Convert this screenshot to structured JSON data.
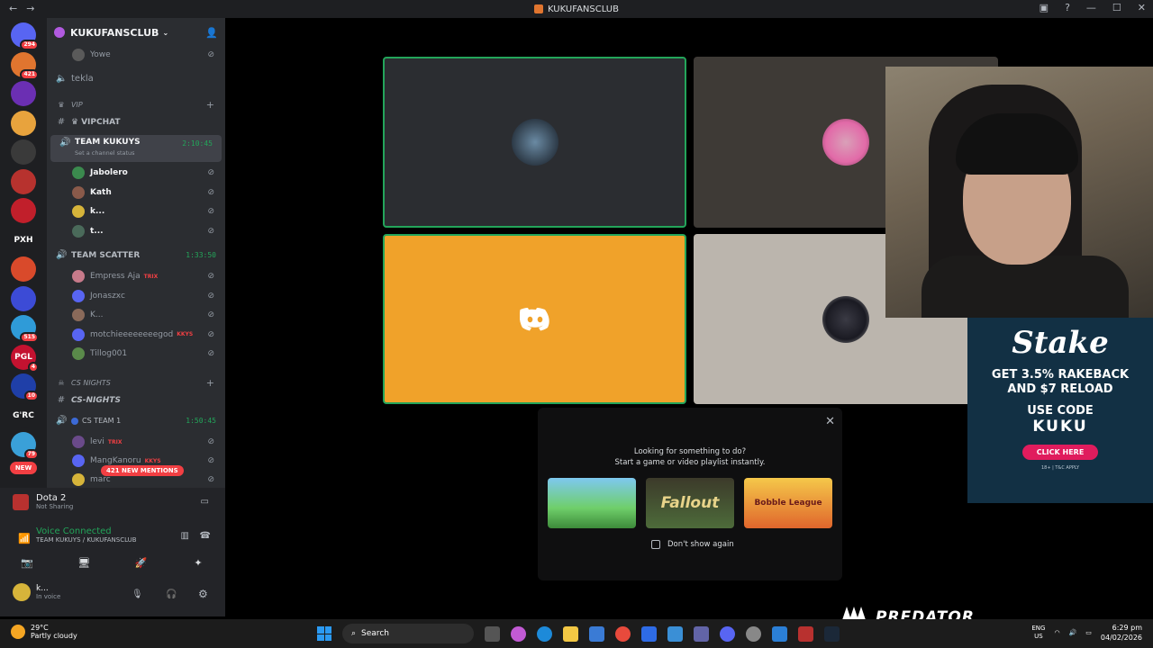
{
  "window": {
    "title": "KUKUFANSCLUB",
    "back": "←",
    "forward": "→"
  },
  "servers": [
    {
      "label": "",
      "badge": "294",
      "color": "#5865f2"
    },
    {
      "label": "",
      "badge": "421",
      "color": "#e0752f"
    },
    {
      "label": "",
      "badge": "",
      "color": "#6b2fb3"
    },
    {
      "label": "",
      "badge": "",
      "color": "#e8a33d"
    },
    {
      "label": "",
      "badge": "",
      "color": "#3a3a3a"
    },
    {
      "label": "",
      "badge": "",
      "color": "#b7322e"
    },
    {
      "label": "",
      "badge": "",
      "color": "#c11f2b"
    },
    {
      "label": "PXH",
      "badge": "",
      "color": "#1e1f22"
    },
    {
      "label": "",
      "badge": "",
      "color": "#d94a2b"
    },
    {
      "label": "",
      "badge": "",
      "color": "#3c4bd6"
    },
    {
      "label": "",
      "badge": "515",
      "color": "#2f9bd8"
    },
    {
      "label": "PGL",
      "badge": "4",
      "color": "#c41230"
    },
    {
      "label": "",
      "badge": "10",
      "color": "#1f3fa8"
    },
    {
      "label": "G'RC",
      "badge": "",
      "color": "#1e1f22"
    },
    {
      "label": "",
      "badge": "79",
      "color": "#3aa0d8"
    },
    {
      "label": "NEW",
      "badge": "",
      "color": "#f23f43"
    }
  ],
  "guild": {
    "name": "KUKUFANSCLUB"
  },
  "channels": {
    "yowe": "Yowe",
    "tekla": "tekla",
    "vip_category": "VIP",
    "vipchat": "VIPCHAT",
    "team_kukuys": "TEAM KUKUYS",
    "team_kukuys_timer": "2:10:45",
    "team_kukuys_status": "Set a channel status",
    "kukuys_members": [
      "Jabolero",
      "Kath",
      "k...",
      "t..."
    ],
    "team_scatter": "TEAM SCATTER",
    "team_scatter_timer": "1:33:50",
    "scatter_members": [
      {
        "name": "Empress Aja",
        "tag": "TRIX"
      },
      {
        "name": "Jonaszxc",
        "tag": ""
      },
      {
        "name": "K...",
        "tag": ""
      },
      {
        "name": "motchieeeeeeeegod",
        "tag": "KKYS"
      },
      {
        "name": "Tillog001",
        "tag": ""
      }
    ],
    "cs_category": "CS NIGHTS",
    "cs_nights": "CS-NIGHTS",
    "cs_team": "CS TEAM 1",
    "cs_team_timer": "1:50:45",
    "cs_members": [
      {
        "name": "levi",
        "tag": "TRIX"
      },
      {
        "name": "MangKanoru",
        "tag": "KKYS"
      },
      {
        "name": "marc",
        "tag": ""
      }
    ],
    "new_mentions": "421 NEW MENTIONS"
  },
  "user_panel": {
    "activity_title": "Dota 2",
    "activity_sub": "Not Sharing",
    "voice_status": "Voice Connected",
    "voice_location": "TEAM KUKUYS / KUKUFANSCLUB",
    "username": "k...",
    "user_status": "In voice"
  },
  "suggestion": {
    "line1": "Looking for something to do?",
    "line2": "Start a game or video playlist instantly.",
    "games": [
      "",
      "Fallout",
      "Bobble League"
    ],
    "dont_show": "Don't show again"
  },
  "stake": {
    "brand": "Stake",
    "promo_line1": "GET 3.5% RAKEBACK",
    "promo_line2": "AND $7 RELOAD",
    "use_code": "USE CODE",
    "code": "KUKU",
    "cta": "CLICK HERE",
    "terms": "18+ | T&C APPLY"
  },
  "overlay_brand": "PREDATOR",
  "taskbar": {
    "temp": "29°C",
    "weather": "Partly cloudy",
    "search_placeholder": "Search",
    "lang1": "ENG",
    "lang2": "US",
    "time": "6:29 pm",
    "date": "04/02/2026"
  },
  "colors": {
    "discord_orange": "#f0a22a",
    "speaking_green": "#23a55a",
    "stake_bg": "#123044",
    "stake_cta": "#e01c5d"
  }
}
